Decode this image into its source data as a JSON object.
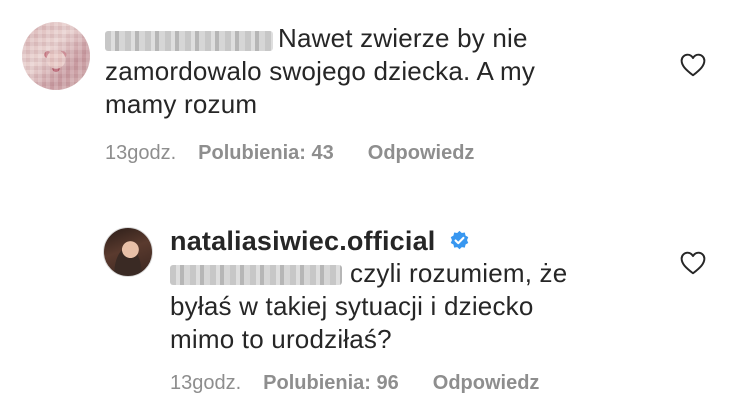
{
  "comments": [
    {
      "text": "Nawet zwierze by nie\nzamordowalo swojego dziecka. A my\nmamy rozum",
      "time": "13godz.",
      "likes": "Polubienia: 43",
      "reply": "Odpowiedz",
      "icons": {
        "like": "heart-outline-icon",
        "avatar": "blurred-avatar"
      }
    },
    {
      "username": "nataliasiwiec.official",
      "text": "czyli rozumiem, że\nbyłaś w takiej sytuacji i dziecko\nmimo to urodziłaś?",
      "time": "13godz.",
      "likes": "Polubienia: 96",
      "reply": "Odpowiedz",
      "icons": {
        "like": "heart-outline-icon",
        "verified": "verified-badge-icon"
      }
    }
  ],
  "colors": {
    "text": "#262626",
    "meta": "#8e8e8e",
    "verified": "#3897f0"
  }
}
